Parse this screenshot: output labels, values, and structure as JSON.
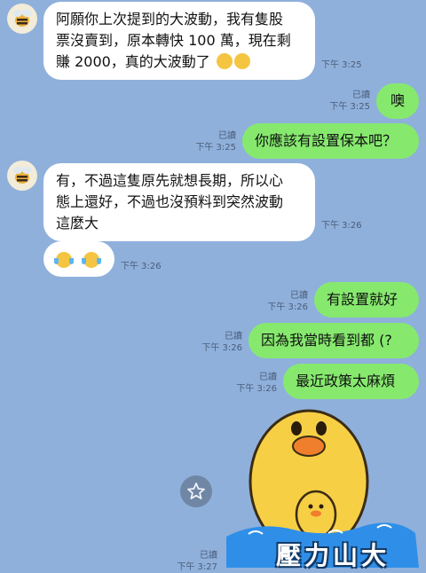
{
  "messages": [
    {
      "side": "in",
      "lines": [
        "阿願你上次提到的大波動，我有隻股",
        "票沒賣到，原本轉快 100 萬，現在剩",
        "賺 2000，真的大波動了"
      ],
      "emojis": [
        "rofl-emoji",
        "rofl-emoji"
      ],
      "time": "下午 3:25"
    },
    {
      "side": "out",
      "text": "噢",
      "read": "已讀",
      "time": "下午 3:25"
    },
    {
      "side": "out",
      "text": "你應該有設置保本吧？",
      "read": "已讀",
      "time": "下午 3:25"
    },
    {
      "side": "in",
      "lines": [
        "有，不過這隻原先就想長期，所以心",
        "態上還好，不過也沒預料到突然波動",
        "這麼大"
      ],
      "time": "下午 3:26"
    },
    {
      "side": "in",
      "emojis": [
        "tears-of-joy-emoji",
        "tears-of-joy-emoji"
      ],
      "time": "下午 3:26"
    },
    {
      "side": "out",
      "text": "有設置就好",
      "read": "已讀",
      "time": "下午 3:26"
    },
    {
      "side": "out",
      "text": "因為我當時看到都 (?",
      "read": "已讀",
      "time": "下午 3:26"
    },
    {
      "side": "out",
      "text": "最近政策太麻煩",
      "read": "已讀",
      "time": "下午 3:26"
    },
    {
      "side": "out",
      "sticker_text": "壓力山大",
      "read": "已讀",
      "time": "下午 3:27"
    }
  ],
  "colors": {
    "background": "#8fb0db",
    "incoming": "#ffffff",
    "outgoing": "#86e96e"
  },
  "icons": {
    "avatar": "bee-avatar-icon",
    "favorite": "star-icon",
    "sticker": "duck-sticker"
  }
}
